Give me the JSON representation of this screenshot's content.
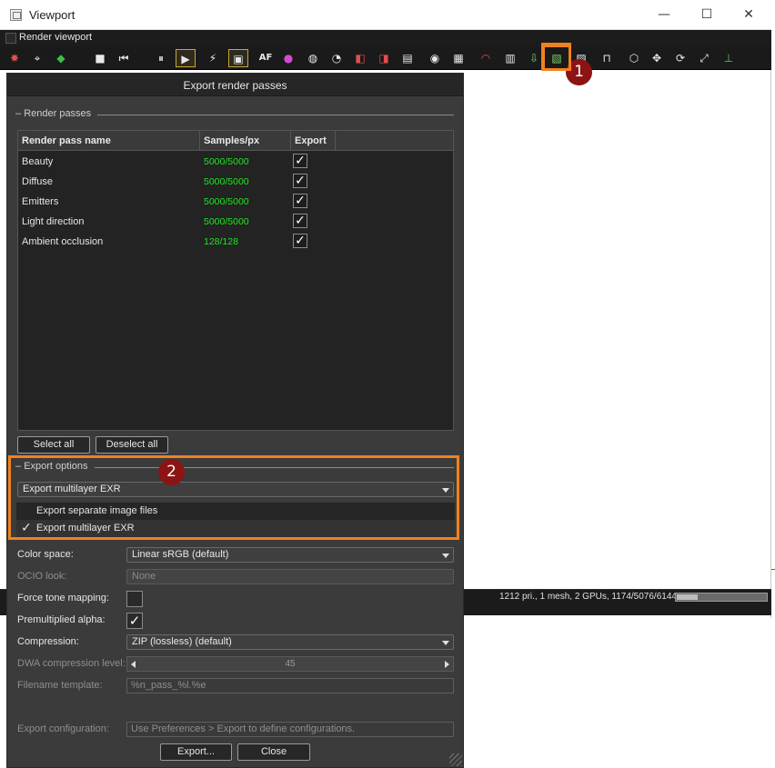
{
  "window": {
    "title": "Viewport",
    "minimize": "—",
    "maximize": "☐",
    "close": "✕"
  },
  "menubar": {
    "checkbox_label": "Render viewport"
  },
  "toolbar": {
    "icons": [
      "stop-render-icon",
      "reset-camera-icon",
      "cube-color-icon",
      "stop-icon",
      "restart-icon",
      "pause-icon",
      "start-icon",
      "flash-icon",
      "screen-icon",
      "af-icon",
      "color-wheel-icon",
      "sphere-icon",
      "light-icon",
      "region-icon",
      "picker-icon",
      "film-icon",
      "zoom-icon",
      "grid-icon",
      "gauge-icon",
      "copy-icon",
      "export-image-icon",
      "export-passes-icon",
      "image-window-icon",
      "lock-icon",
      "camera-cube-icon",
      "move-icon",
      "rotate-icon",
      "fit-icon",
      "axis-icon"
    ],
    "glyphs": {
      "stop": "■",
      "restart": "⏮",
      "pause": "⏸",
      "start": "▶",
      "flash": "⚡",
      "af": "AF",
      "move": "✥",
      "rotate": "⟳",
      "fit": "⤢"
    }
  },
  "status": {
    "text": "1212 pri., 1 mesh, 2 GPUs, 1174/5076/6144 MB",
    "memory_fraction": 0.23
  },
  "dialog": {
    "title": "Export render passes",
    "render_passes_heading": "Render passes",
    "columns": [
      "Render pass name",
      "Samples/px",
      "Export"
    ],
    "rows": [
      {
        "name": "Beauty",
        "samples": "5000/5000",
        "export": "✓"
      },
      {
        "name": "Diffuse",
        "samples": "5000/5000",
        "export": "✓"
      },
      {
        "name": "Emitters",
        "samples": "5000/5000",
        "export": "✓"
      },
      {
        "name": "Light direction",
        "samples": "5000/5000",
        "export": "✓"
      },
      {
        "name": "Ambient occlusion",
        "samples": "128/128",
        "export": "✓"
      }
    ],
    "select_all": "Select all",
    "deselect_all": "Deselect all",
    "export_options_heading": "Export options",
    "export_mode": "Export multilayer EXR",
    "export_mode_options": [
      {
        "label": "Export separate image files",
        "checked": ""
      },
      {
        "label": "Export multilayer EXR",
        "checked": "✓"
      }
    ],
    "fields": {
      "color_space_label": "Color space:",
      "color_space_value": "Linear sRGB (default)",
      "ocio_look_label": "OCIO look:",
      "ocio_look_value": "None",
      "force_tone_mapping_label": "Force tone mapping:",
      "force_tone_mapping_value": "",
      "premultiplied_alpha_label": "Premultiplied alpha:",
      "premultiplied_alpha_value": "✓",
      "compression_label": "Compression:",
      "compression_value": "ZIP (lossless) (default)",
      "dwa_label": "DWA compression level:",
      "dwa_value": "45",
      "filename_template_label": "Filename template:",
      "filename_template_value": "%n_pass_%l.%e",
      "export_configuration_label": "Export configuration:",
      "export_configuration_value": "Use Preferences > Export to define configurations."
    },
    "export_button": "Export...",
    "close_button": "Close"
  },
  "annotations": {
    "badge1": "1",
    "badge2": "2",
    "highlight_color": "#f0821e",
    "badge_color": "#8c1414"
  }
}
